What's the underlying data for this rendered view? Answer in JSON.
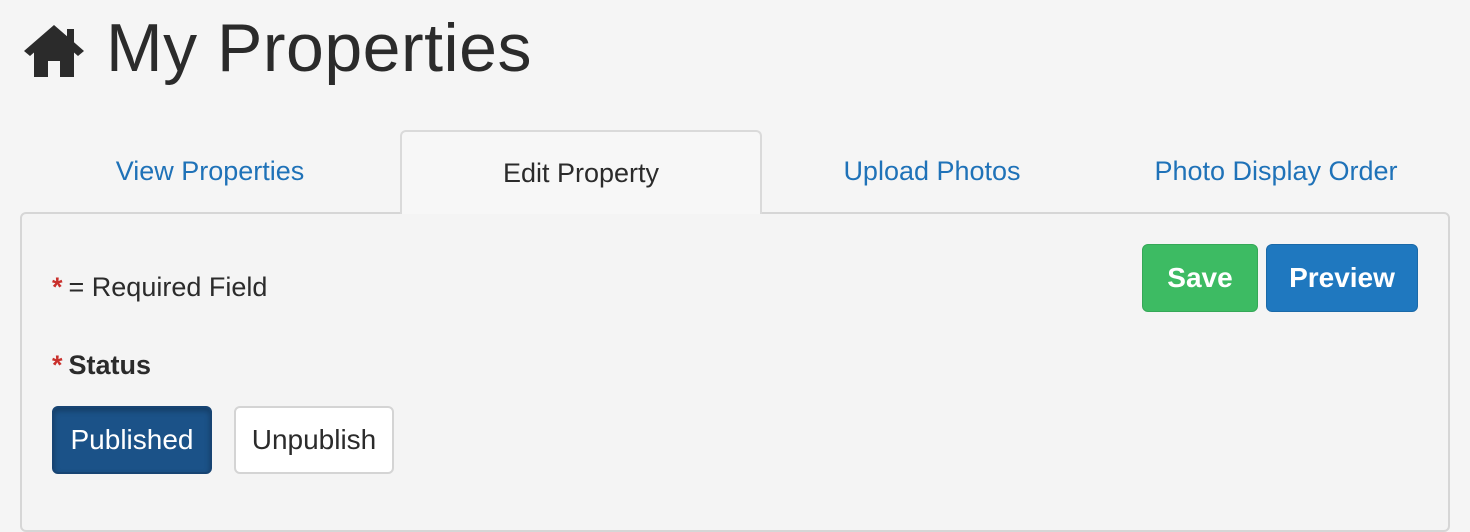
{
  "header": {
    "title": "My Properties",
    "icon": "home-icon"
  },
  "tabs": [
    {
      "label": "View Properties",
      "active": false
    },
    {
      "label": "Edit Property",
      "active": true
    },
    {
      "label": "Upload Photos",
      "active": false
    },
    {
      "label": "Photo Display Order",
      "active": false
    }
  ],
  "form": {
    "required_asterisk": "*",
    "required_note": "= Required Field",
    "status_label": "Status",
    "status_options": [
      {
        "label": "Published",
        "selected": true
      },
      {
        "label": "Unpublish",
        "selected": false
      }
    ]
  },
  "actions": {
    "save_label": "Save",
    "preview_label": "Preview"
  },
  "colors": {
    "link": "#1f72b8",
    "save": "#3dbb63",
    "preview": "#1f78bf",
    "published": "#1b5288",
    "required": "#c9302c"
  }
}
